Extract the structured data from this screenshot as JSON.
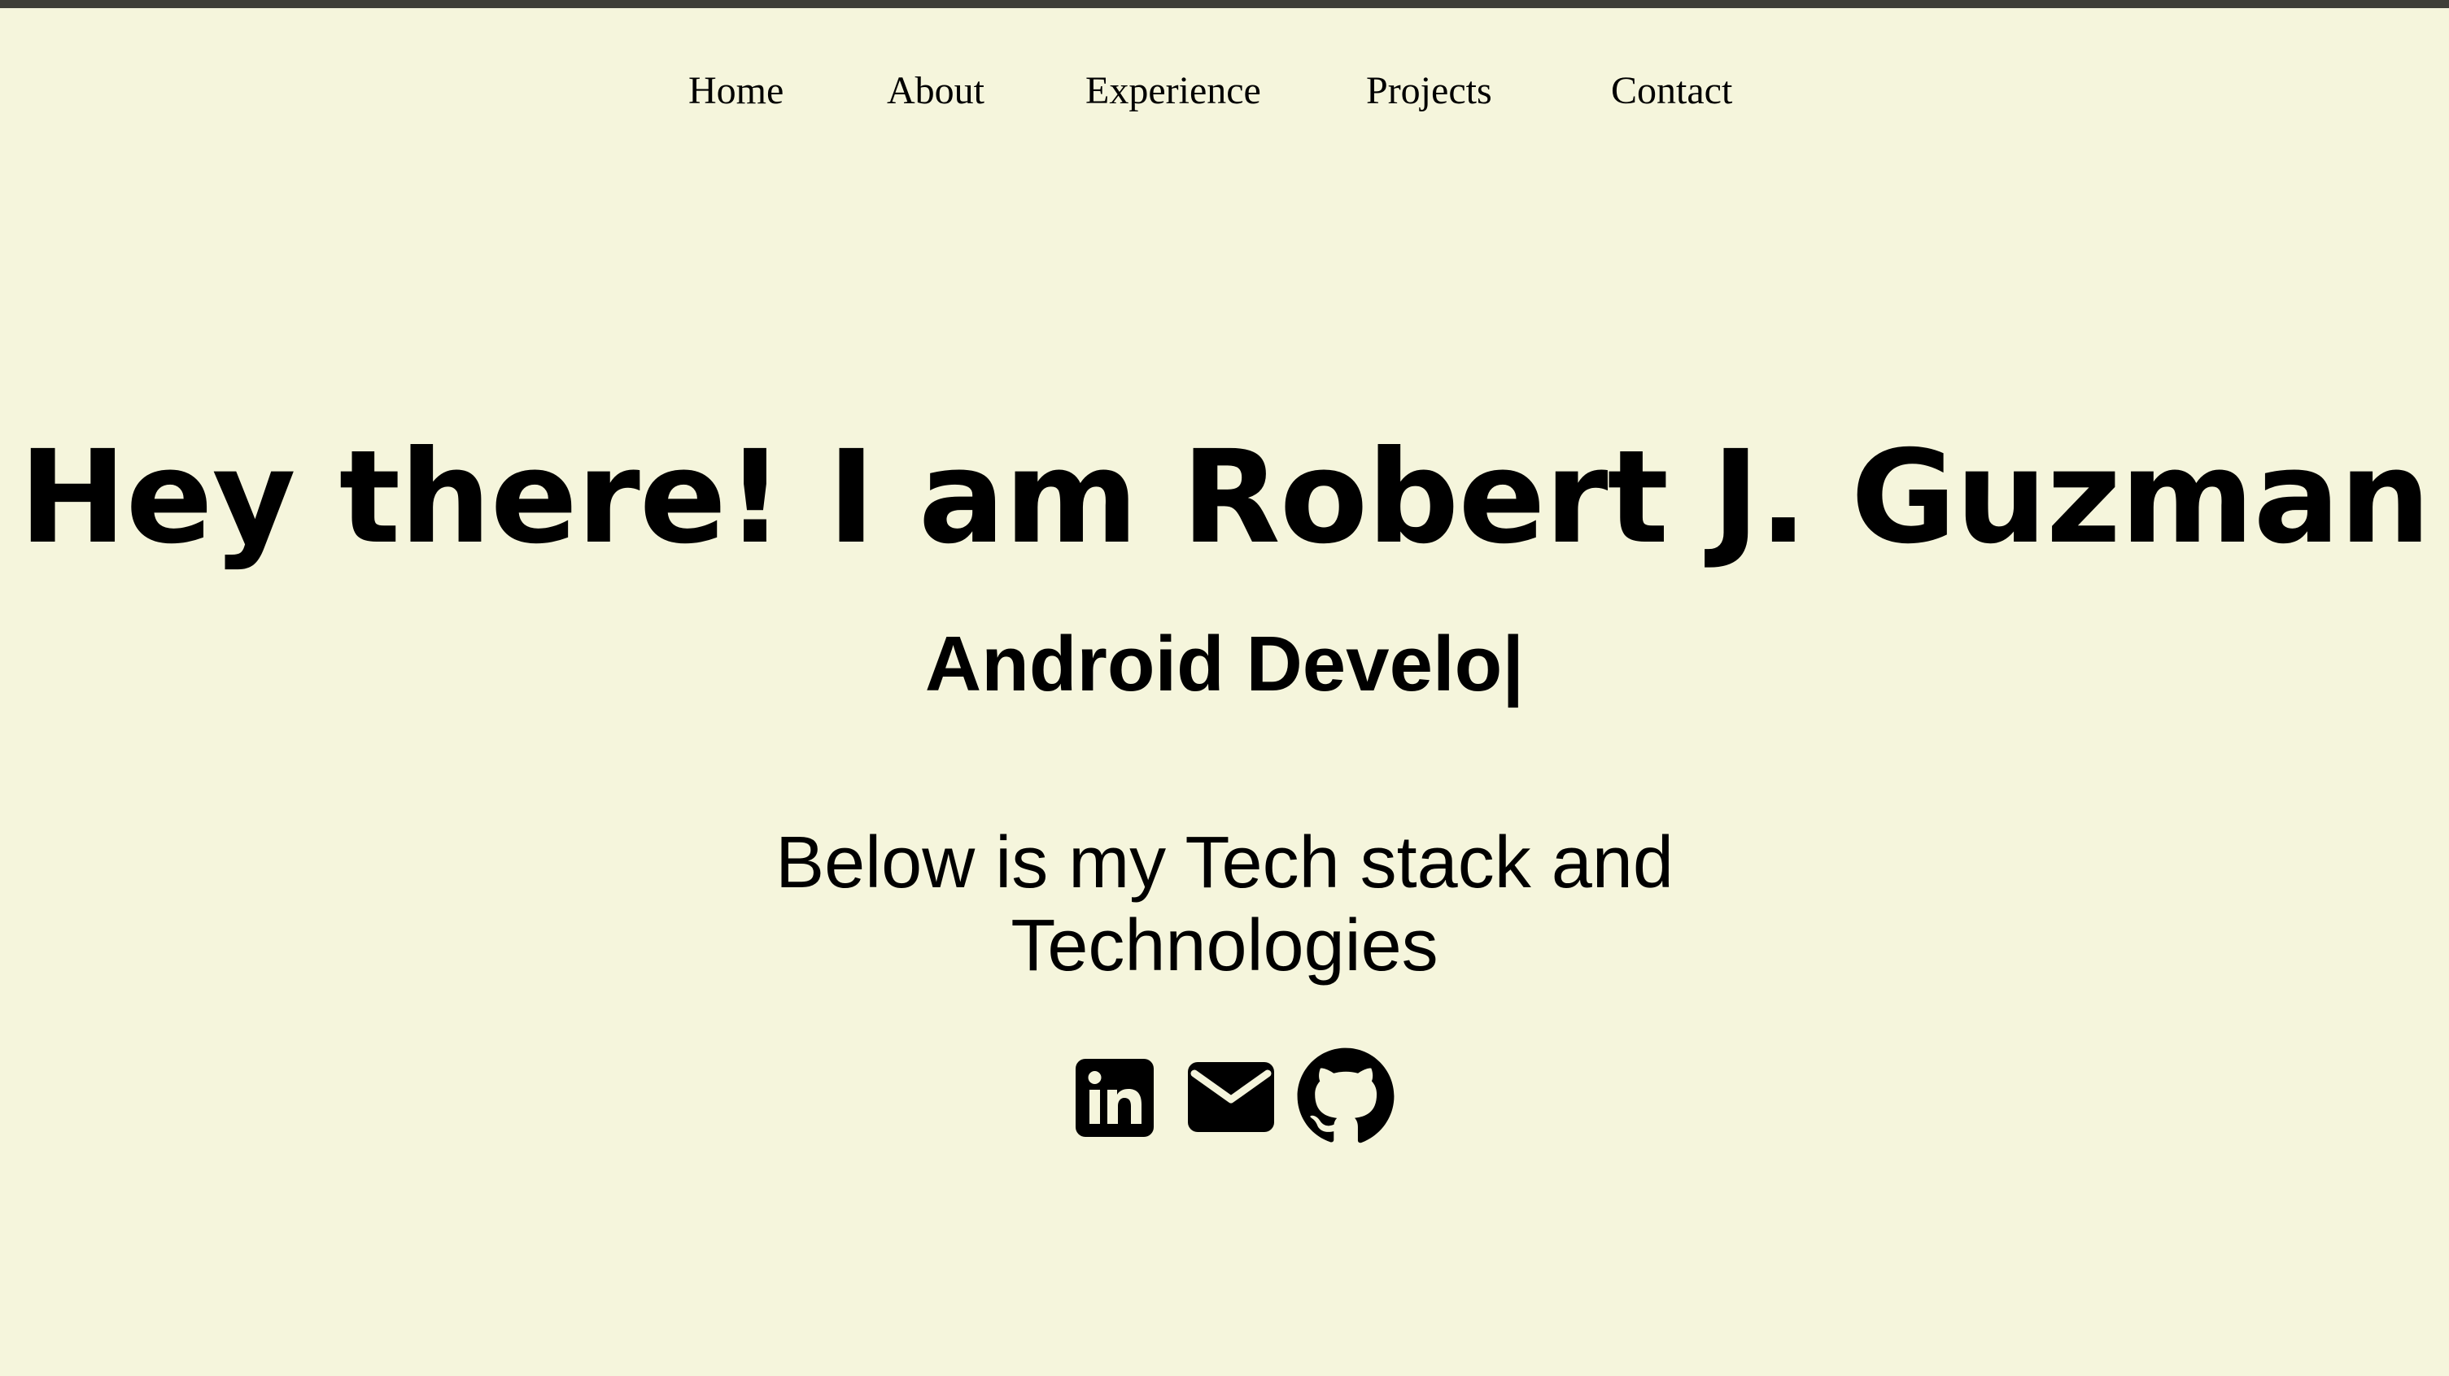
{
  "nav": {
    "items": [
      {
        "label": "Home"
      },
      {
        "label": "About"
      },
      {
        "label": "Experience"
      },
      {
        "label": "Projects"
      },
      {
        "label": "Contact"
      }
    ]
  },
  "hero": {
    "title": "Hey there! I am Robert J. Guzman",
    "subtitle": "Android Develo|",
    "intro_line1": "Below is my Tech stack and",
    "intro_line2": "Technologies"
  },
  "socials": [
    {
      "icon": "linkedin-icon"
    },
    {
      "icon": "email-icon"
    },
    {
      "icon": "github-icon"
    }
  ],
  "colors": {
    "background": "#f5f5dc",
    "top_border": "#3f3f38",
    "text": "#000000"
  }
}
